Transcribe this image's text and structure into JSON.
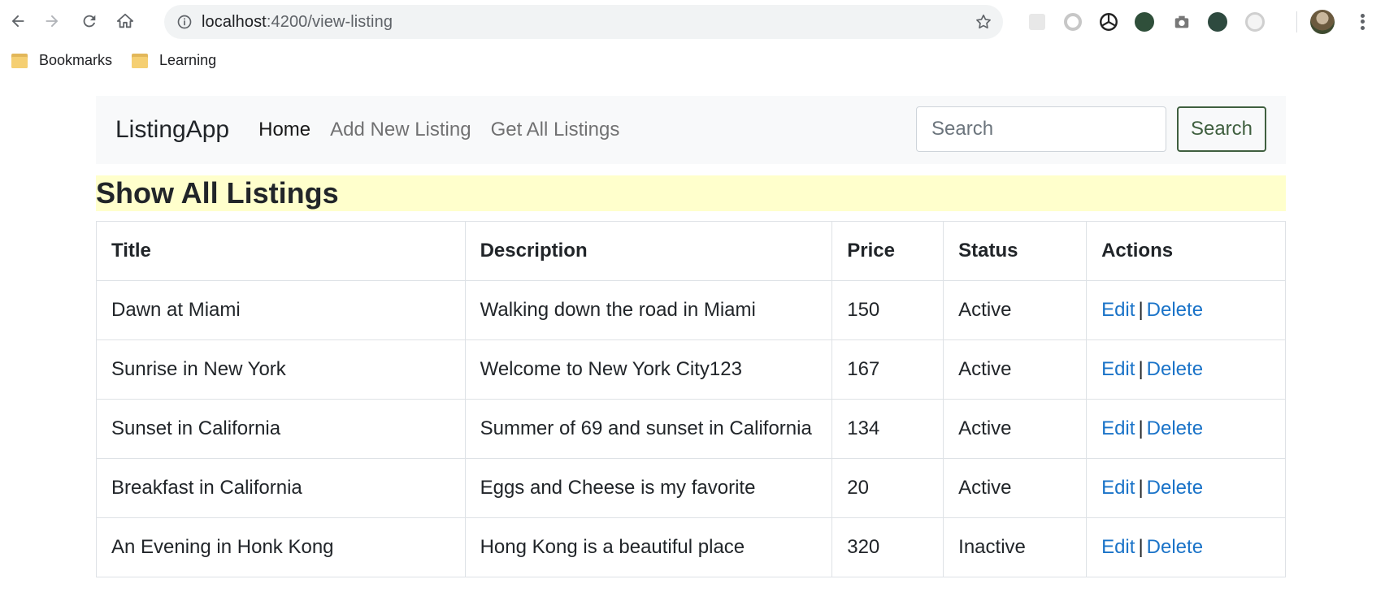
{
  "browser": {
    "url_host": "localhost",
    "url_path": ":4200/view-listing",
    "bookmarks": [
      "Bookmarks",
      "Learning"
    ]
  },
  "navbar": {
    "brand": "ListingApp",
    "links": [
      "Home",
      "Add New Listing",
      "Get All Listings"
    ],
    "search_placeholder": "Search",
    "search_button": "Search"
  },
  "page": {
    "heading": "Show All Listings"
  },
  "table": {
    "headers": [
      "Title",
      "Description",
      "Price",
      "Status",
      "Actions"
    ],
    "rows": [
      {
        "title": "Dawn at Miami",
        "description": "Walking down the road in Miami",
        "price": "150",
        "status": "Active"
      },
      {
        "title": "Sunrise in New York",
        "description": "Welcome to New York City123",
        "price": "167",
        "status": "Active"
      },
      {
        "title": "Sunset in California",
        "description": "Summer of 69 and sunset in California",
        "price": "134",
        "status": "Active"
      },
      {
        "title": "Breakfast in California",
        "description": "Eggs and Cheese is my favorite",
        "price": "20",
        "status": "Active"
      },
      {
        "title": "An Evening in Honk Kong",
        "description": "Hong Kong is a beautiful place",
        "price": "320",
        "status": "Inactive"
      }
    ],
    "edit_label": "Edit",
    "separator": "|",
    "delete_label": "Delete"
  },
  "colors": {
    "heading_bg": "#ffffcc",
    "navbar_bg": "#f8f9fa",
    "link_blue": "#1a73c8",
    "search_button_border": "#3f5f3f"
  },
  "icons": [
    "back-arrow-icon",
    "forward-arrow-icon",
    "reload-icon",
    "home-icon",
    "info-icon",
    "star-icon",
    "folder-icon",
    "menu-dots-icon"
  ]
}
